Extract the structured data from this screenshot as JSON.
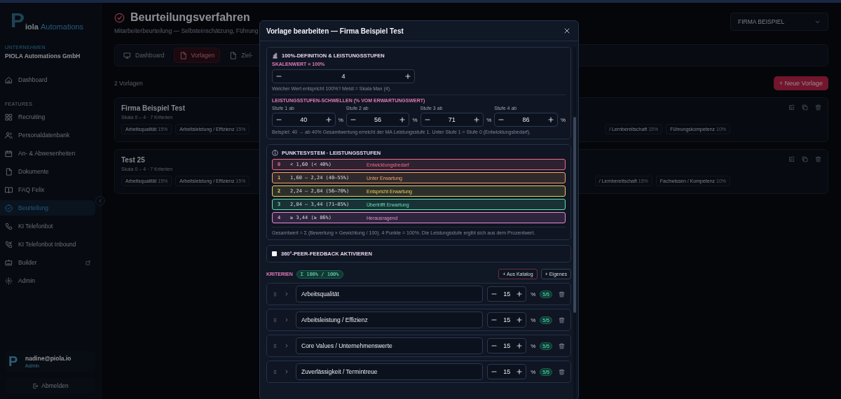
{
  "sidebar": {
    "logo": {
      "mark": "P",
      "word": "iola",
      "suffix": "Automations"
    },
    "company_label": "UNTERNEHMEN",
    "company_name": "PIOLA Automations GmbH",
    "main_items": [
      {
        "label": "Dashboard",
        "selected": false
      }
    ],
    "section_label": "FEATURES",
    "features": [
      {
        "label": "Recruiting",
        "selected": false,
        "external": false
      },
      {
        "label": "Personaldatenbank",
        "selected": false,
        "external": false
      },
      {
        "label": "An- & Abwesenheiten",
        "selected": false,
        "external": false
      },
      {
        "label": "Dokumente",
        "selected": false,
        "external": false
      },
      {
        "label": "FAQ Felix",
        "selected": false,
        "external": false
      },
      {
        "label": "Beurteilung",
        "selected": true,
        "external": false
      },
      {
        "label": "KI Telefonbot",
        "selected": false,
        "external": false
      },
      {
        "label": "KI Telefonbot Inbound",
        "selected": false,
        "external": false
      },
      {
        "label": "Builder",
        "selected": false,
        "external": true
      },
      {
        "label": "Admin",
        "selected": false,
        "external": false
      }
    ],
    "user": {
      "avatar": "P",
      "email": "nadine@piola.io",
      "role": "Admin"
    },
    "logout": "Abmelden"
  },
  "header": {
    "title": "Beurteilungsverfahren",
    "subtitle": "Mitarbeiterbeurteilung — Selbsteinschätzung, Führung",
    "company_select": "FIRMA BEISPIEL"
  },
  "tabs": [
    {
      "label": "Dashboard",
      "selected": false
    },
    {
      "label": "Vorlagen",
      "selected": true
    },
    {
      "label": "Ziel-",
      "selected": false
    }
  ],
  "templates": {
    "count": "2 Vorlagen",
    "new_button": "+ Neue Vorlage",
    "cards": [
      {
        "title": "Firma Beispiel Test",
        "meta": "Skala 0 – 4 · 7 Kriterien",
        "chips_left": [
          {
            "name": "Arbeitsqualität",
            "weight": "15%"
          },
          {
            "name": "Arbeitsleistung / Effizienz",
            "weight": "15%"
          }
        ],
        "chips_right": [
          {
            "name": "/ Lernbereitschaft",
            "weight": "15%"
          },
          {
            "name": "Führungskompetenz",
            "weight": "10%"
          }
        ]
      },
      {
        "title": "Test 25",
        "meta": "Skala 0 – 4 · 7 Kriterien",
        "chips_left": [
          {
            "name": "Arbeitsqualität",
            "weight": "15%"
          },
          {
            "name": "Arbeitsleistung / Effizienz",
            "weight": "15%"
          }
        ],
        "chips_right": [
          {
            "name": "/ Lernbereitschaft",
            "weight": "15%"
          },
          {
            "name": "Fachwissen / Kompetenz",
            "weight": "10%"
          }
        ]
      }
    ]
  },
  "modal": {
    "title": "Vorlage bearbeiten — Firma Beispiel Test",
    "definition": {
      "title": "100%-DEFINITION & LEISTUNGSSTUFEN",
      "scale_label": "SKALENWERT = 100%",
      "scale_value": "4",
      "scale_hint": "Welcher Wert entspricht 100%? Meist = Skala Max (4).",
      "thresholds_label": "LEISTUNGSSTUFEN-SCHWELLEN (% VOM ERWARTUNGSWERT)",
      "thresholds": [
        {
          "label": "Stufe 1 ab",
          "value": "40",
          "unit": "%"
        },
        {
          "label": "Stufe 2 ab",
          "value": "56",
          "unit": "%"
        },
        {
          "label": "Stufe 3 ab",
          "value": "71",
          "unit": "%"
        },
        {
          "label": "Stufe 4 ab",
          "value": "86",
          "unit": "%"
        }
      ],
      "note": "Beispiel: 40 → ab 40% Gesamtwertung erreicht der MA Leistungsstufe 1. Unter Stufe 1 = Stufe 0 (Entwicklungsbedarf)."
    },
    "points": {
      "title": "PUNKTESYSTEM · LEISTUNGSSTUFEN",
      "levels": [
        {
          "level": "0",
          "range": "< 1,60 (< 40%)",
          "name": "Entwicklungsbedarf",
          "color": "#f06a8a"
        },
        {
          "level": "1",
          "range": "1,60 – 2,24 (40–55%)",
          "name": "Unter Erwartung",
          "color": "#f5a468"
        },
        {
          "level": "2",
          "range": "2,24 – 2,84 (56–70%)",
          "name": "Entspricht Erwartung",
          "color": "#ead35a"
        },
        {
          "level": "3",
          "range": "2,84 – 3,44 (71–85%)",
          "name": "Übertrifft Erwartung",
          "color": "#5fe0b4"
        },
        {
          "level": "4",
          "range": "≥ 3,44 (≥ 86%)",
          "name": "Herausragend",
          "color": "#e88ad8"
        }
      ],
      "formula": "Gesamtwert = Σ (Bewertung × Gewichtung / 100). 4 Punkte = 100%. Die Leistungsstufe ergibt sich aus dem Prozentwert."
    },
    "peer_feedback": {
      "label": "360°-PEER-FEEDBACK AKTIVIEREN",
      "checked": false
    },
    "criteria": {
      "label": "KRITERIEN",
      "sum": "Σ 100% / 100%",
      "catalog_button": "+ Aus Katalog",
      "custom_button": "+ Eigenes",
      "rows": [
        {
          "name": "Arbeitsqualität",
          "weight": "15",
          "unit": "%",
          "scale": "5/5",
          "expanded": false
        },
        {
          "name": "Arbeitsleistung / Effizienz",
          "weight": "15",
          "unit": "%",
          "scale": "5/5",
          "expanded": false
        },
        {
          "name": "Core Values / Unternehmenswerte",
          "weight": "15",
          "unit": "%",
          "scale": "5/5",
          "expanded": false
        },
        {
          "name": "Zuverlässigkeit / Termintreue",
          "weight": "15",
          "unit": "%",
          "scale": "5/5",
          "expanded": false
        }
      ]
    }
  }
}
